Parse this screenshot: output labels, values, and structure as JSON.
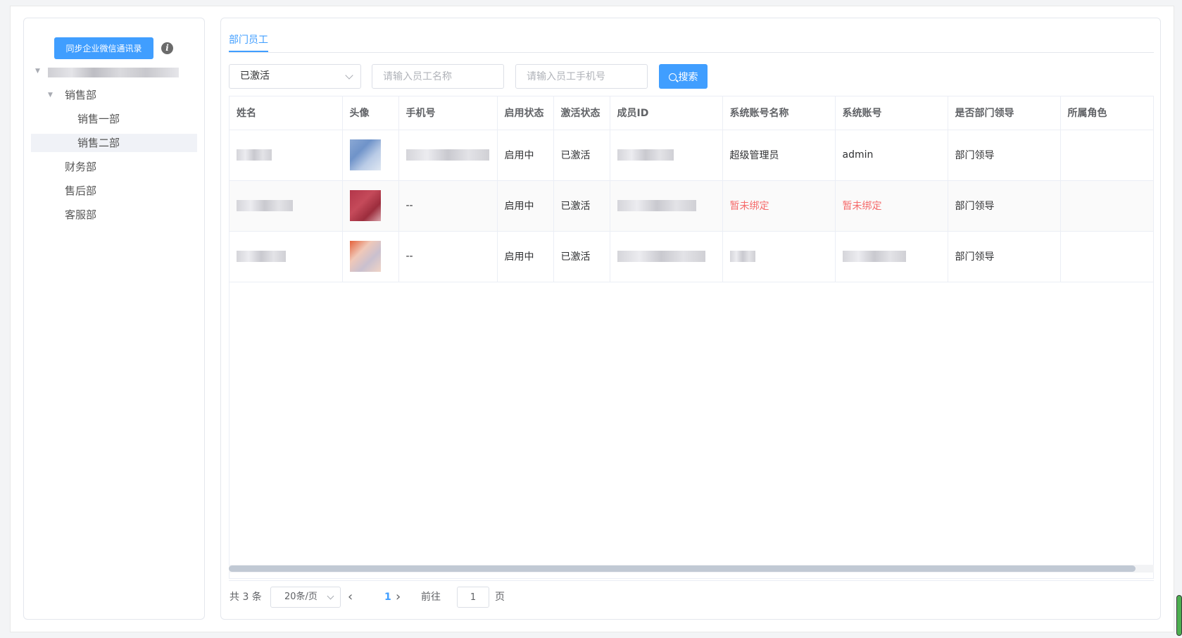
{
  "sidebar": {
    "sync_button": "同步企业微信通讯录",
    "info_icon": "i",
    "tree": [
      {
        "label": "",
        "expanded": true
      },
      {
        "label": "销售部",
        "expanded": true
      },
      {
        "label": "销售一部"
      },
      {
        "label": "销售二部",
        "selected": true
      },
      {
        "label": "财务部"
      },
      {
        "label": "售后部"
      },
      {
        "label": "客服部"
      }
    ]
  },
  "main": {
    "tab": "部门员工",
    "filters": {
      "status_selected": "已激活",
      "name_placeholder": "请输入员工名称",
      "phone_placeholder": "请输入员工手机号",
      "search_button": "搜索"
    },
    "table": {
      "columns": [
        "姓名",
        "头像",
        "手机号",
        "启用状态",
        "激活状态",
        "成员ID",
        "系统账号名称",
        "系统账号",
        "是否部门领导",
        "所属角色"
      ],
      "rows": [
        {
          "phone": "",
          "enable_status": "启用中",
          "active_status": "已激活",
          "sys_name": "超级管理员",
          "sys_account": "admin",
          "is_leader": "部门领导",
          "role": ""
        },
        {
          "phone": "--",
          "enable_status": "启用中",
          "active_status": "已激活",
          "sys_name": "暂未绑定",
          "sys_account": "暂未绑定",
          "is_leader": "部门领导",
          "role": ""
        },
        {
          "phone": "--",
          "enable_status": "启用中",
          "active_status": "已激活",
          "sys_name": "",
          "sys_account": "",
          "is_leader": "部门领导",
          "role": ""
        }
      ]
    },
    "pagination": {
      "total": "共 3 条",
      "page_size": "20条/页",
      "current_page": "1",
      "goto_label": "前往",
      "goto_value": "1",
      "page_unit": "页"
    }
  }
}
